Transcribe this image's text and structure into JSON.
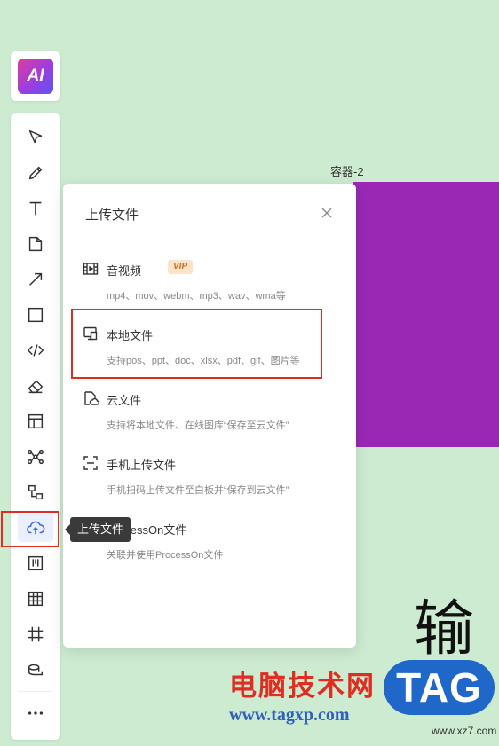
{
  "ai_button": {
    "label": "AI"
  },
  "toolbar": {
    "tools": [
      {
        "name": "select-tool",
        "icon": "pointer-icon"
      },
      {
        "name": "pen-tool",
        "icon": "pencil-icon"
      },
      {
        "name": "text-tool",
        "icon": "text-icon"
      },
      {
        "name": "note-tool",
        "icon": "note-icon"
      },
      {
        "name": "arrow-tool",
        "icon": "arrow-icon"
      },
      {
        "name": "rectangle-tool",
        "icon": "square-icon"
      },
      {
        "name": "code-tool",
        "icon": "code-icon"
      },
      {
        "name": "eraser-tool",
        "icon": "eraser-icon"
      },
      {
        "name": "template-tool",
        "icon": "layout-icon"
      },
      {
        "name": "mindmap-tool",
        "icon": "mindmap-icon"
      },
      {
        "name": "flowchart-tool",
        "icon": "flowchart-icon"
      },
      {
        "name": "upload-tool",
        "icon": "cloud-upload-icon"
      },
      {
        "name": "kanban-tool",
        "icon": "kanban-icon"
      },
      {
        "name": "table-tool",
        "icon": "table-icon"
      },
      {
        "name": "frame-tool",
        "icon": "frame-icon"
      },
      {
        "name": "tape-tool",
        "icon": "tape-icon"
      },
      {
        "name": "more-tool",
        "icon": "more-icon"
      }
    ],
    "upload_tooltip": "上传文件"
  },
  "canvas": {
    "container_label": "容器-2",
    "big_char": "输"
  },
  "upload_panel": {
    "title": "上传文件",
    "options": [
      {
        "title": "音视频",
        "badge": "VIP",
        "desc": "mp4、mov、webm、mp3、wav、wma等"
      },
      {
        "title": "本地文件",
        "desc": "支持pos、ppt、doc、xlsx、pdf、gif、图片等"
      },
      {
        "title": "云文件",
        "desc": "支持将本地文件、在线图库“保存至云文件”"
      },
      {
        "title": "手机上传文件",
        "desc": "手机扫码上传文件至白板并“保存到云文件”"
      },
      {
        "title": "ProcessOn文件",
        "desc": "关联并使用ProcessOn文件"
      }
    ]
  },
  "watermark": {
    "text": "电脑技术网",
    "url": "www.tagxp.com",
    "logo": "TAG",
    "site": "www.xz7.com"
  },
  "colors": {
    "canvas_bg": "#cdebd0",
    "purple_box": "#9a28b4",
    "highlight_red": "#e02d22",
    "accent_blue": "#3d6cf0"
  }
}
